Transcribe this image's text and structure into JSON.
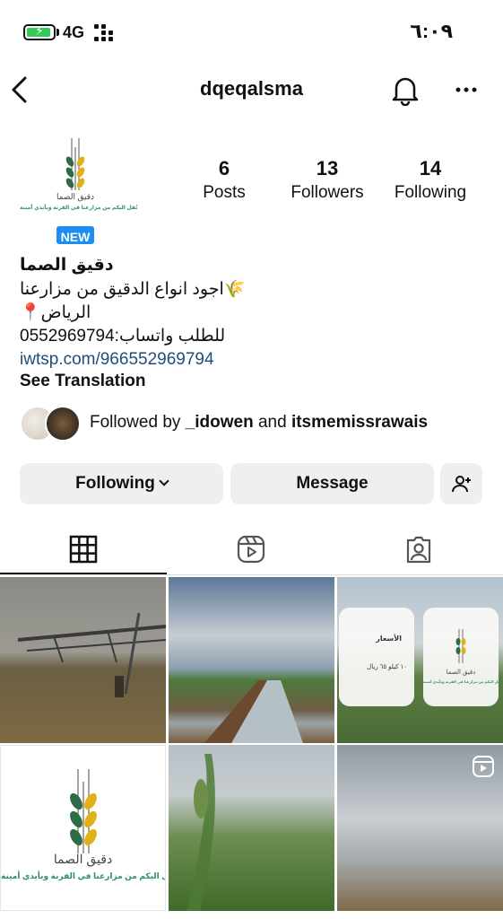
{
  "status_bar": {
    "network": "4G",
    "time": "٦:٠٩"
  },
  "header": {
    "username": "dqeqalsma"
  },
  "profile": {
    "new_badge": "NEW",
    "logo_text": "دقيق الصما",
    "logo_tagline": "نُقل اليكم من مزارعنا في القرنة وبأيدي أمينة",
    "stats": [
      {
        "value": "6",
        "label": "Posts"
      },
      {
        "value": "13",
        "label": "Followers"
      },
      {
        "value": "14",
        "label": "Following"
      }
    ],
    "name": "دقيق الصما",
    "bio_lines": [
      "اجود انواع الدقيق من مزارعنا🌾",
      "📍الرياض",
      "للطلب واتساب:0552969794"
    ],
    "link": "iwtsp.com/966552969794",
    "see_translation": "See Translation",
    "followed_by": {
      "prefix": "Followed by ",
      "user1": "_idowen",
      "joiner": " and ",
      "user2": "itsmemissrawais"
    }
  },
  "actions": {
    "following": "Following",
    "message": "Message"
  },
  "grid": {
    "card_title": "الأسعار",
    "card_price": "١٠ كيلو   ٦٥ ريال",
    "card_logo_text": "دقيق الصما",
    "card_logo_tag": "نُقل اليكم من مزارعنا في القرنة وبأيدي أمينة",
    "post_logo_text": "دقيق الصما",
    "post_logo_tag": "نُقل اليكم من مزارعنا في القرنة وبأيدي أمينة"
  },
  "colors": {
    "badge": "#1c8ef2",
    "link": "#1f4e79",
    "wheat_green": "#2f6b45",
    "wheat_gold": "#e0b21a"
  }
}
